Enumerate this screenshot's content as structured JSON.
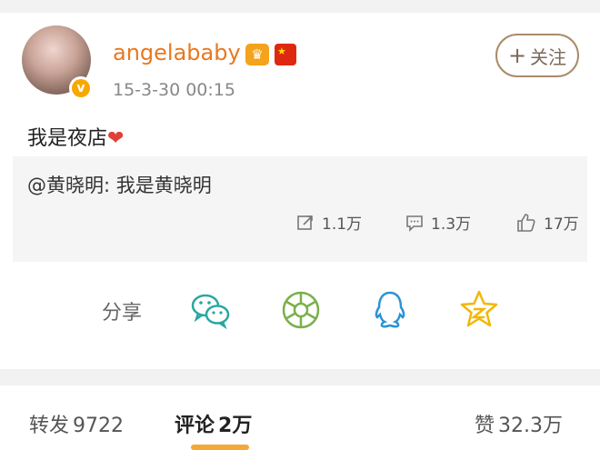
{
  "post": {
    "username": "angelababy",
    "timestamp": "15-3-30 00:15",
    "follow_button": "关注",
    "content": "我是夜店",
    "repost": {
      "text": "@黄晓明: 我是黄晓明",
      "reposts": "1.1万",
      "comments": "1.3万",
      "likes": "17万"
    }
  },
  "share": {
    "label": "分享",
    "icons": [
      "wechat-icon",
      "moments-icon",
      "qq-icon",
      "qzone-icon"
    ]
  },
  "tabs": [
    {
      "label": "转发",
      "count": "9722"
    },
    {
      "label": "评论",
      "count": "2万"
    },
    {
      "label": "赞",
      "count": "32.3万"
    }
  ],
  "colors": {
    "username": "#e8781e",
    "accent": "#f3a93a",
    "share_icons": "#2aa7a1"
  }
}
